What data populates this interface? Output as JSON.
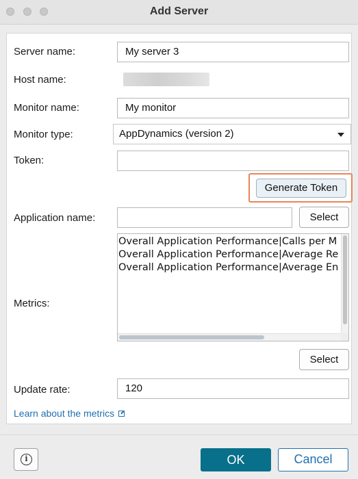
{
  "window": {
    "title": "Add Server",
    "traffic_lights": [
      "close",
      "minimize",
      "zoom"
    ]
  },
  "form": {
    "server_name": {
      "label": "Server name:",
      "value": "My server 3"
    },
    "host_name": {
      "label": "Host name:",
      "value": ""
    },
    "monitor_name": {
      "label": "Monitor name:",
      "value": "My monitor"
    },
    "monitor_type": {
      "label": "Monitor type:",
      "value": "AppDynamics (version 2)"
    },
    "token": {
      "label": "Token:",
      "value": ""
    },
    "generate_token_label": "Generate Token",
    "application_name": {
      "label": "Application name:",
      "value": "",
      "select_label": "Select"
    },
    "metrics": {
      "label": "Metrics:",
      "items": [
        "Overall Application Performance|Calls per M",
        "Overall Application Performance|Average Re",
        "Overall Application Performance|Average En"
      ],
      "select_label": "Select"
    },
    "update_rate": {
      "label": "Update rate:",
      "value": "120"
    }
  },
  "links": {
    "learn_metrics": "Learn about the metrics"
  },
  "footer": {
    "info_icon": "i",
    "ok_label": "OK",
    "cancel_label": "Cancel"
  },
  "colors": {
    "accent": "#08708a",
    "link": "#1f6fb0",
    "highlight_border": "#e8845a"
  }
}
